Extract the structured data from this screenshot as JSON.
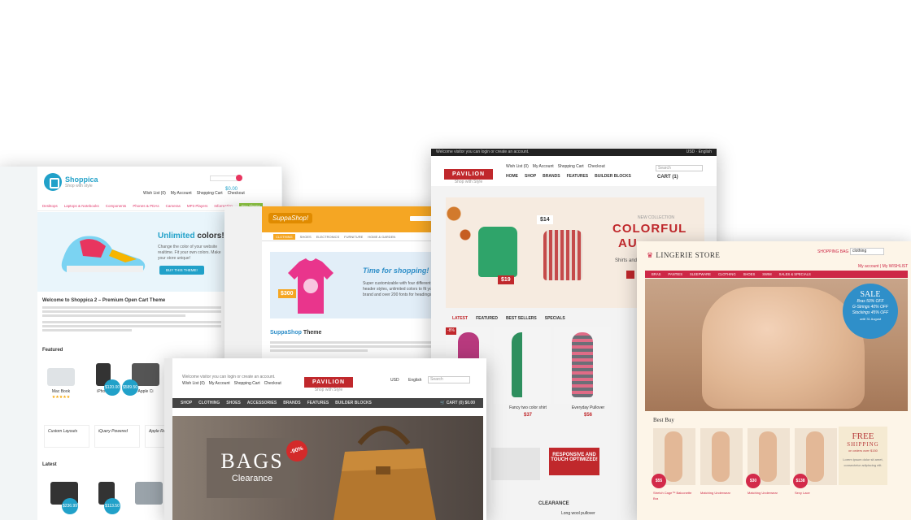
{
  "shoppica": {
    "logo": "Shoppica",
    "tagline": "Shop with style",
    "account_links": [
      "Wish List (0)",
      "My Account",
      "Shopping Cart",
      "Checkout"
    ],
    "cart_total": "$0.00",
    "categories": [
      "Desktops",
      "Laptops & Notebooks",
      "Components",
      "Phones & PDAs",
      "Cameras",
      "MP3 Players",
      "Information",
      "Buy Theme"
    ],
    "hero_title_accent": "Unlimited",
    "hero_title_rest": "colors!",
    "hero_text": "Change the color of your website realtime. Fit your own colors. Make your store unique!",
    "hero_button": "BUY THIS THEME!",
    "welcome_title": "Welcome to Shoppica 2 – Premium Open Cart Theme",
    "featured_label": "Featured",
    "featured": [
      {
        "name": "Mac Book",
        "price": ""
      },
      {
        "name": "iPhone",
        "price": "$120.00"
      },
      {
        "name": "Apple Ci",
        "price": "$589.50"
      }
    ],
    "latest_label": "Latest",
    "latest_prices": [
      "$236.99",
      "$113.50"
    ],
    "promo_labels": [
      "Custom Layouts",
      "iQuery Powered",
      "Apple Ready!"
    ]
  },
  "suppashop": {
    "logo": "SuppaShop!",
    "nav": [
      "CLOTHING",
      "SHOES",
      "ELECTRONICS",
      "FURNITURE",
      "HOME & GARDEN"
    ],
    "banner_title": "Time for shopping!",
    "banner_text": "Super customizable with four different header styles, unlimited colors to fit your brand and over 200 fonts for headings.",
    "price": "$300",
    "section_title_accent": "SuppaShop",
    "section_title_rest": "Theme"
  },
  "pavilion_back": {
    "topbar_text": "Welcome visitor you can login or create an account.",
    "currency": "USD",
    "language": "English",
    "logo": "PAVILION",
    "logo_sub": "Shop with Style",
    "account_links": [
      "Wish List (0)",
      "My Account",
      "Shopping Cart",
      "Checkout"
    ],
    "search_placeholder": "Search",
    "cart": "CART (1)",
    "nav": [
      "HOME",
      "SHOP",
      "BRANDS",
      "FEATURES",
      "BUILDER BLOCKS"
    ],
    "hero_kicker": "NEW COLLECTION",
    "hero_title_1": "COLORFUL",
    "hero_title_2": "AU",
    "hero_sub": "Shirts and",
    "tag_left": "$19",
    "tag_right": "$14",
    "tabs": [
      "LATEST",
      "FEATURED",
      "BEST SELLERS",
      "SPECIALS"
    ],
    "discount": "-8%",
    "products": [
      {
        "name": "Fancy two color shirt",
        "price": "$37"
      },
      {
        "name": "Everyday Pullover",
        "price": "$56"
      }
    ],
    "promo": "RESPONSIVE AND TOUCH OPTIMIZED!",
    "clearance": "CLEARANCE",
    "long_item": "Long wool pullover"
  },
  "lingerie": {
    "logo": "LINGERIE STORE",
    "bag": "SHOPPING BAG",
    "account_links": [
      "My account",
      "My WISHLIST"
    ],
    "search_value": "clothing",
    "nav": [
      "BRAS",
      "PANTIES",
      "SLEEPWARE",
      "CLOTHING",
      "SHOES",
      "SWIM",
      "SALES & SPECIALS"
    ],
    "sale_title": "SALE",
    "sale_lines": [
      "Bras 50% OFF",
      "G-Strings 40% OFF",
      "Stockings 45% OFF"
    ],
    "sale_until": "until 31 August",
    "best_buy": "Best Buy",
    "prices": [
      "$55",
      "$30",
      "$138"
    ],
    "product_names": [
      "Stretch Cage™ Balconette Bra",
      "Matching Underwear",
      "Matching Underwear",
      "Sexy Lace"
    ],
    "free_1": "FREE",
    "free_2": "SHIPPING",
    "free_3": "on orders over $150",
    "free_text": "Lorem ipsum dolor sit amet, consectetur adipiscing elit."
  },
  "pavilion_front": {
    "topbar_text": "Welcome visitor you can login or create an account.",
    "account_links": [
      "Wish List (0)",
      "My Account",
      "Shopping Cart",
      "Checkout"
    ],
    "logo": "PAVILION",
    "logo_sub": "Shop with Style",
    "currency": "USD",
    "language": "English",
    "search_placeholder": "Search",
    "nav": [
      "SHOP",
      "CLOTHING",
      "SHOES",
      "ACCESSORIES",
      "BRANDS",
      "FEATURES",
      "BUILDER BLOCKS"
    ],
    "cart": "CART",
    "cart_count": "(0)",
    "cart_total": "$0.00",
    "hero_title": "BAGS",
    "hero_sub": "Clearance",
    "discount": "-90%"
  }
}
